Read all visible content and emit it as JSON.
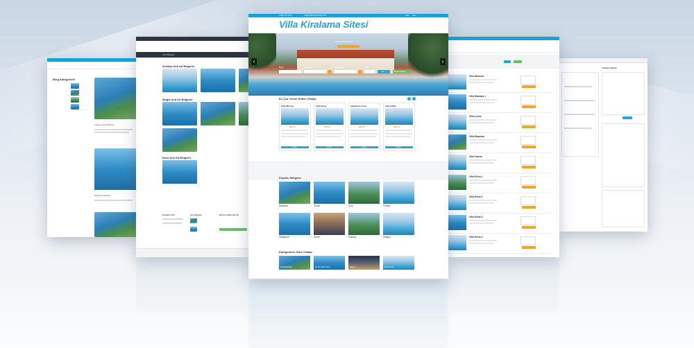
{
  "main_page": {
    "topbar_phone": "0 850 123 45 67",
    "topbar_email": "info@villakiralamasitesi.com",
    "topbar_links": [
      "Giriş",
      "Kayıt"
    ],
    "site_title": "Villa Kiralama Sitesi",
    "hero_heading": "Villa Kiralama Sitesi",
    "search": {
      "fields": [
        "Bölge",
        "Giriş Tarihi",
        "Çıkış Tarihi",
        "Kişi"
      ],
      "button_label": "Ara",
      "button2_label": "Detaylı Arama"
    },
    "featured_section_title": "En Çok Tercih Edilen Villalar",
    "featured": [
      {
        "name": "Villa Mimoza",
        "price": "650 TL"
      },
      {
        "name": "Villa Kuzey",
        "price": "700 TL"
      },
      {
        "name": "Villa Deniz Gözü",
        "price": "800 TL"
      },
      {
        "name": "Villa Çiftlik",
        "price": "900 TL"
      }
    ],
    "card_button_label": "İncele",
    "regions_section_title": "Popüler Bölgeler",
    "regions": [
      "Dalaman",
      "Göcek",
      "Çırış",
      "Fethiye",
      "Sarıgerme",
      "Girme",
      "Kaleköy",
      "Antalya"
    ],
    "categories_section_title": "Kategorilere Göre Villalar",
    "categories": [
      "Muhafazakar",
      "Deniz Manzaralı",
      "Balayı",
      "Ekonomik"
    ]
  },
  "left_page": {
    "header": "Tüm Bölgeler",
    "section1_title": "Antalya Ana Alt Bölgeler",
    "region1_labels": [
      "Kaş",
      "Kalkan"
    ],
    "section2_title": "Muğla Ana Alt Bölgeler",
    "region2_labels": [
      "Fethiye",
      "Marmaris",
      "Dalaman"
    ],
    "section3_title": "İzmir Ana Alt Bölgeler",
    "region3_labels": [
      "Çeşme"
    ],
    "footer_cols": [
      "Bölgelerimiz",
      "Son Bloglar",
      "Bizden Haberdar Ol"
    ]
  },
  "far_left_page": {
    "sidebar_title": "Blog Kategorileri",
    "post_titles": [
      "Fethiye Gezi Rehberi",
      "Ölüdeniz Rehberi"
    ]
  },
  "right_page": {
    "villas": [
      "Villa Mimoza",
      "Villa Mahaba 1",
      "Villa Lotus",
      "Villa Başaran",
      "Villa Harem",
      "Villa Reha 1",
      "Villa Reha 2",
      "Villa Reha 3",
      "Villa Reha 4"
    ],
    "row_button_label": "İncele"
  },
  "far_right_page": {
    "header": "Yönetim Paneli"
  }
}
